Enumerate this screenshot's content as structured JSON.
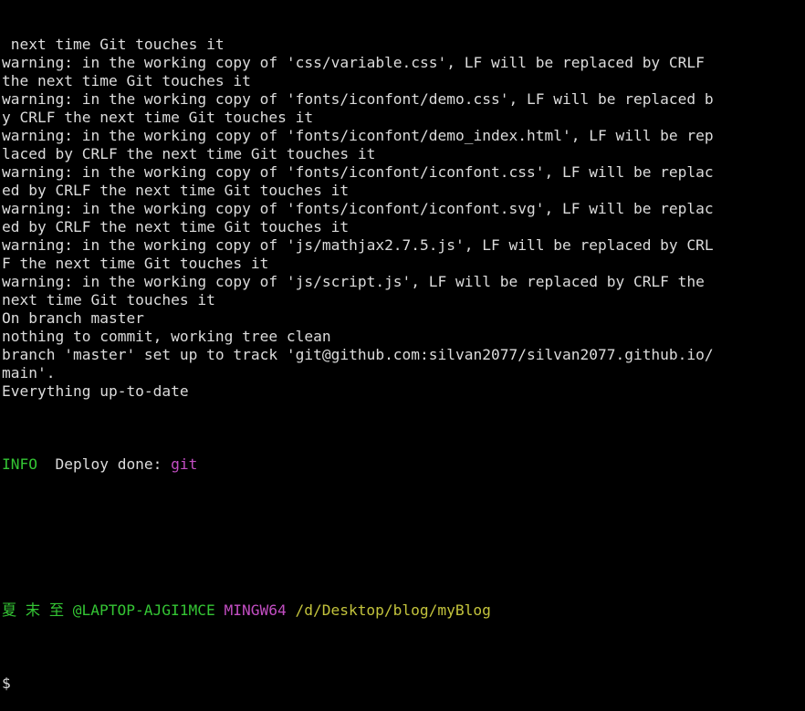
{
  "terminal": {
    "output_lines": [
      " next time Git touches it",
      "warning: in the working copy of 'css/variable.css', LF will be replaced by CRLF",
      "the next time Git touches it",
      "warning: in the working copy of 'fonts/iconfont/demo.css', LF will be replaced b",
      "y CRLF the next time Git touches it",
      "warning: in the working copy of 'fonts/iconfont/demo_index.html', LF will be rep",
      "laced by CRLF the next time Git touches it",
      "warning: in the working copy of 'fonts/iconfont/iconfont.css', LF will be replac",
      "ed by CRLF the next time Git touches it",
      "warning: in the working copy of 'fonts/iconfont/iconfont.svg', LF will be replac",
      "ed by CRLF the next time Git touches it",
      "warning: in the working copy of 'js/mathjax2.7.5.js', LF will be replaced by CRL",
      "F the next time Git touches it",
      "warning: in the working copy of 'js/script.js', LF will be replaced by CRLF the",
      "next time Git touches it",
      "On branch master",
      "nothing to commit, working tree clean",
      "branch 'master' set up to track 'git@github.com:silvan2077/silvan2077.github.io/",
      "main'.",
      "Everything up-to-date"
    ],
    "info_line": {
      "tag": "INFO",
      "message": "  Deploy done: ",
      "target": "git"
    },
    "prompt": {
      "user_host": "夏 末 至 @LAPTOP-AJGI1MCE",
      "system": "MINGW64",
      "path": "/d/Desktop/blog/myBlog",
      "symbol": "$"
    },
    "colors": {
      "background": "#000000",
      "text": "#dcdcdc",
      "green": "#34c534",
      "magenta": "#c34ec3",
      "yellow": "#c3c33c"
    }
  }
}
